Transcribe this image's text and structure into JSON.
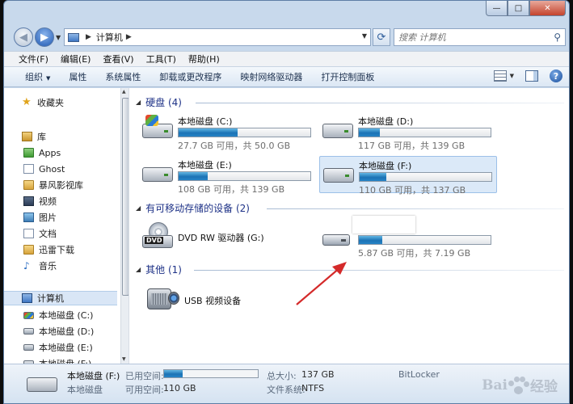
{
  "window": {
    "min_label": "—",
    "max_label": "□",
    "close_label": "✕"
  },
  "address": {
    "location": "计算机"
  },
  "search": {
    "placeholder": "搜索 计算机"
  },
  "menu": [
    "文件(F)",
    "编辑(E)",
    "查看(V)",
    "工具(T)",
    "帮助(H)"
  ],
  "toolbar": {
    "organize": "组织",
    "items": [
      "属性",
      "系统属性",
      "卸载或更改程序",
      "映射网络驱动器",
      "打开控制面板"
    ],
    "help": "?"
  },
  "nav": {
    "favorites": "收藏夹",
    "library": "库",
    "library_items": [
      "Apps",
      "Ghost",
      "暴风影视库",
      "视频",
      "图片",
      "文档",
      "迅雷下载",
      "音乐"
    ],
    "computer": "计算机",
    "drives": [
      "本地磁盘 (C:)",
      "本地磁盘 (D:)",
      "本地磁盘 (E:)",
      "本地磁盘 (F:)"
    ]
  },
  "groups": {
    "hdd": "硬盘 (4)",
    "removable": "有可移动存储的设备 (2)",
    "other": "其他 (1)"
  },
  "drives": [
    {
      "name": "本地磁盘 (C:)",
      "info": "27.7 GB 可用，共 50.0 GB",
      "used_fraction": 0.45
    },
    {
      "name": "本地磁盘 (D:)",
      "info": "117 GB 可用，共 139 GB",
      "used_fraction": 0.16
    },
    {
      "name": "本地磁盘 (E:)",
      "info": "108 GB 可用，共 139 GB",
      "used_fraction": 0.22
    },
    {
      "name": "本地磁盘 (F:)",
      "info": "110 GB 可用，共 137 GB",
      "used_fraction": 0.2
    }
  ],
  "dvd": {
    "label": "DVD RW 驱动器 (G:)",
    "badge": "DVD"
  },
  "usb_drive": {
    "info": "5.87 GB 可用，共 7.19 GB",
    "used_fraction": 0.18
  },
  "other_device": {
    "label": "USB 视频设备"
  },
  "details": {
    "name": "本地磁盘 (F:)",
    "type": "本地磁盘",
    "used_label": "已用空间:",
    "free_label": "可用空间:",
    "free_value": "110 GB",
    "total_label": "总大小:",
    "total_value": "137 GB",
    "fs_label": "文件系统:",
    "fs_value": "NTFS",
    "bitlocker": "BitLocker",
    "used_fraction": 0.2
  },
  "watermark": {
    "brand_b": "Bai",
    "brand_text": "经验"
  },
  "colors": {
    "accent": "#1c73b5",
    "group_header": "#1e3287",
    "selection": "#dbe9f8",
    "arrow": "#d42a2a"
  }
}
